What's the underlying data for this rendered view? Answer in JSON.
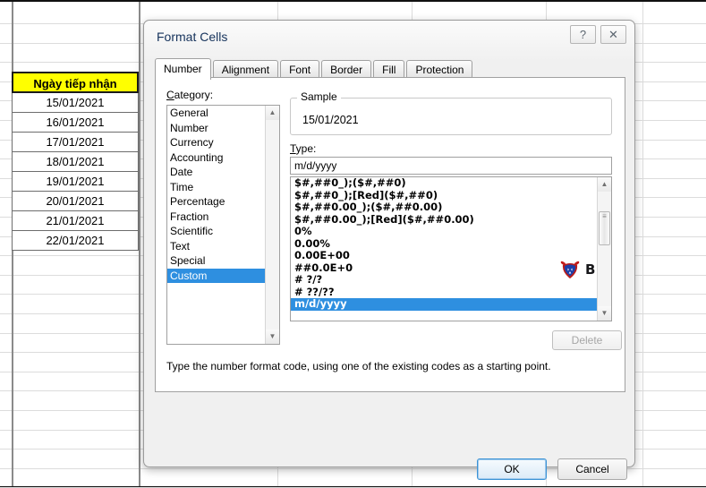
{
  "worksheet": {
    "column_header": "Ngày tiếp nhận",
    "header_bg": "#ffff00",
    "dates": [
      "15/01/2021",
      "16/01/2021",
      "17/01/2021",
      "18/01/2021",
      "19/01/2021",
      "20/01/2021",
      "21/01/2021",
      "22/01/2021"
    ]
  },
  "dialog": {
    "title": "Format Cells",
    "help_button": "?",
    "close_button": "✕",
    "tabs": [
      {
        "label": "Number",
        "active": true
      },
      {
        "label": "Alignment",
        "active": false
      },
      {
        "label": "Font",
        "active": false
      },
      {
        "label": "Border",
        "active": false
      },
      {
        "label": "Fill",
        "active": false
      },
      {
        "label": "Protection",
        "active": false
      }
    ],
    "category": {
      "label": "Category:",
      "items": [
        "General",
        "Number",
        "Currency",
        "Accounting",
        "Date",
        "Time",
        "Percentage",
        "Fraction",
        "Scientific",
        "Text",
        "Special",
        "Custom"
      ],
      "selected": "Custom"
    },
    "sample": {
      "legend": "Sample",
      "value": "15/01/2021"
    },
    "type": {
      "label": "Type:",
      "value": "m/d/yyyy",
      "items": [
        "$#,##0_);($#,##0)",
        "$#,##0_);[Red]($#,##0)",
        "$#,##0.00_);($#,##0.00)",
        "$#,##0.00_);[Red]($#,##0.00)",
        "0%",
        "0.00%",
        "0.00E+00",
        "##0.0E+0",
        "# ?/?",
        "# ??/??",
        "m/d/yyyy"
      ],
      "selected": "m/d/yyyy"
    },
    "delete_label": "Delete",
    "help_text": "Type the number format code, using one of the existing codes as a starting point.",
    "ok_label": "OK",
    "cancel_label": "Cancel",
    "selection_color": "#2e8fe0"
  },
  "watermark": {
    "text": "BUFFCOM",
    "icon": "bull-mascot-icon"
  }
}
